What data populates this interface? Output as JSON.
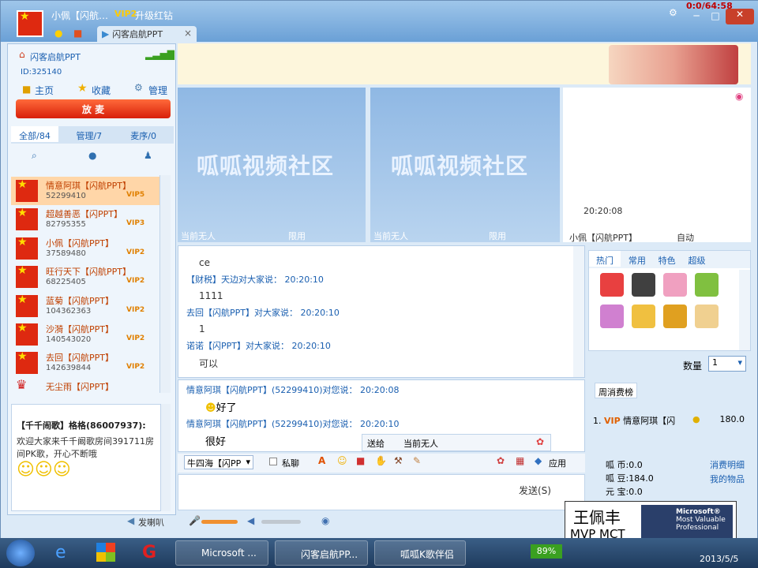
{
  "title": {
    "user_name": "小佩【闪航…",
    "vip_text": "VIP2",
    "upgrade_text": "升级红钻",
    "tab_label": "闪客启航PPT",
    "timer": "0:0/64:58"
  },
  "left": {
    "room_name": "闪客启航PPT",
    "room_id": "ID:325140",
    "home_label": "主页",
    "fav_label": "收藏",
    "manage_label": "管理",
    "mic_button": "放 麦",
    "tabs": [
      "全部/84",
      "管理/7",
      "麦序/0"
    ],
    "contacts": [
      {
        "name": "情意阿琪【闪航PPT】",
        "id": "52299410",
        "vip": "VIP5"
      },
      {
        "name": "超越善恶【闪PPT】",
        "id": "82795355",
        "vip": "VIP3"
      },
      {
        "name": "小佩【闪航PPT】",
        "id": "37589480",
        "vip": "VIP2"
      },
      {
        "name": "旺行天下【闪航PPT】",
        "id": "68225405",
        "vip": "VIP2"
      },
      {
        "name": "蓝菊【闪航PPT】",
        "id": "104362363",
        "vip": "VIP2"
      },
      {
        "name": "沙漪【闪航PPT】",
        "id": "140543020",
        "vip": "VIP2"
      },
      {
        "name": "去回【闪航PPT】",
        "id": "142639844",
        "vip": "VIP2"
      },
      {
        "name": "无尘雨【闪PPT】",
        "id": "",
        "vip": ""
      }
    ],
    "notice_title": "【千千闹歌】格格(86007937):",
    "notice_body": "欢迎大家来千千阚歌房间391711房间PK歌，开心不断哦",
    "speaker_label": "发喇叭"
  },
  "video": {
    "watermark": "呱呱视频社区",
    "left_label": "当前无人",
    "left_mode": "限用",
    "right_label": "当前无人",
    "right_mode": "限用",
    "third_time": "20:20:08",
    "third_label": "小佩【闪航PPT】",
    "third_mode": "自动"
  },
  "chat_public": [
    {
      "header": "【财税】天边对大家说： 20:20:10",
      "body": "1111"
    },
    {
      "header": "去回【闪航PPT】对大家说： 20:20:10",
      "body": "1"
    },
    {
      "header": "诺诺【闪PPT】对大家说： 20:20:10",
      "body": "可以"
    }
  ],
  "chat_partial_top": "ce",
  "chat_private": [
    {
      "header": "情意阿琪【闪航PPT】(52299410)对您说： 20:20:08",
      "body": "好了"
    },
    {
      "header": "情意阿琪【闪航PPT】(52299410)对您说： 20:20:10",
      "body": "很好"
    }
  ],
  "gift_bar": {
    "send_to_label": "送给",
    "send_to_value": "当前无人"
  },
  "input_bar": {
    "target": "牛四海【闪PP",
    "private_label": "私聊",
    "apply_label": "应用",
    "send_button": "发送(S)"
  },
  "gifts": {
    "tabs": [
      "热门",
      "常用",
      "特色",
      "超级"
    ],
    "quantity_label": "数量",
    "quantity_value": "1",
    "weekly_tab": "周消费榜",
    "rank": {
      "num": "1.",
      "vip": "VIP",
      "name": "情意阿琪【闪",
      "value": "180.0"
    },
    "coin_label": "呱  币:0.0",
    "bean_label": "呱  豆:184.0",
    "yuan_label": "元  宝:0.0",
    "details_link": "消费明细",
    "items_link": "我的物品"
  },
  "mvp": {
    "name": "王佩丰",
    "title": "MVP  MCT",
    "badge1": "Microsoft®",
    "badge2": "Most Valuable",
    "badge3": "Professional"
  },
  "taskbar": {
    "items": [
      "Microsoft ...",
      "闪客启航PP...",
      "呱呱K歌伴侣"
    ],
    "battery": "89%",
    "date": "2013/5/5"
  },
  "colors": {
    "accent": "#1a5fb0",
    "mic_red": "#d8200a",
    "flag_red": "#de2910"
  }
}
